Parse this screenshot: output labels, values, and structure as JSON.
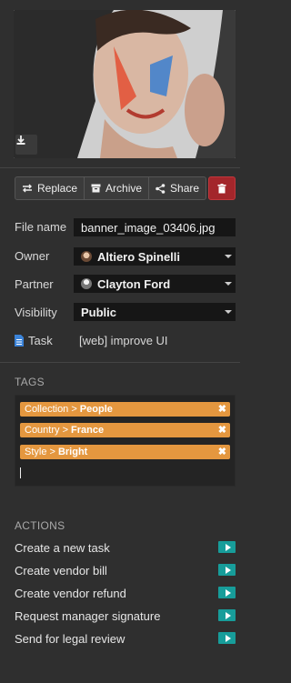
{
  "toolbar": {
    "replace_label": "Replace",
    "archive_label": "Archive",
    "share_label": "Share"
  },
  "fields": {
    "file_name_label": "File name",
    "file_name_value": "banner_image_03406.jpg",
    "owner_label": "Owner",
    "owner_value": "Altiero Spinelli",
    "partner_label": "Partner",
    "partner_value": "Clayton Ford",
    "visibility_label": "Visibility",
    "visibility_value": "Public",
    "task_label": "Task",
    "task_value": "[web] improve UI"
  },
  "tags": {
    "title": "TAGS",
    "items": [
      {
        "category": "Collection >",
        "value": "People"
      },
      {
        "category": "Country >",
        "value": "France"
      },
      {
        "category": "Style >",
        "value": "Bright"
      }
    ],
    "remove_glyph": "✖"
  },
  "actions": {
    "title": "ACTIONS",
    "items": [
      {
        "label": "Create a new task"
      },
      {
        "label": "Create vendor bill"
      },
      {
        "label": "Create vendor refund"
      },
      {
        "label": "Request manager signature"
      },
      {
        "label": "Send for legal review"
      }
    ]
  },
  "colors": {
    "background": "#2f2f2f",
    "tag": "#e4973f",
    "action_button": "#179d9a",
    "delete_button": "#a3262b"
  }
}
